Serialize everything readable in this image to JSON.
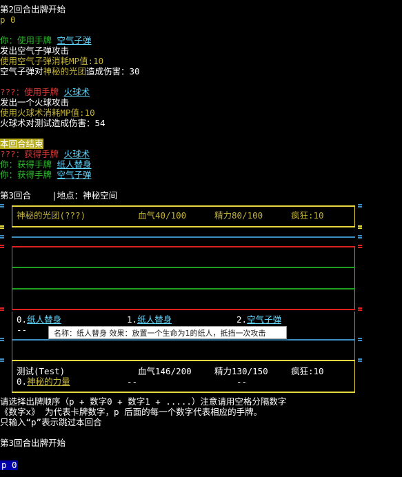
{
  "colors": {
    "white": "#ffffff",
    "green": "#2fbf2f",
    "olive": "#c4b33a",
    "red": "#d43a3a",
    "cyan": "#5fd7ff",
    "yellow_border": "#e6d73c",
    "blue_line": "#3b8fc4",
    "red_line": "#e02020",
    "green_line": "#1f9f1f"
  },
  "log": {
    "round2_start": "第2回合出牌开始",
    "p0_echo": "p 0",
    "you_use_prefix": "你：使用手牌 ",
    "card_air_bullet": "空气子弹",
    "fire_air": "发出空气子弹攻击",
    "air_mp": "使用空气子弹消耗MP值:10",
    "air_dmg_prefix": "空气子弹对",
    "air_dmg_target": "神秘的光团",
    "air_dmg_suffix": "造成伤害：30",
    "enemy_use_prefix": "???：使用手牌 ",
    "card_fireball": "火球术",
    "fire_fireball": "发出一个火球攻击",
    "fireball_mp": "使用火球术消耗MP值:10",
    "fireball_dmg": "火球术对测试造成伤害：54",
    "round_end": "本回合结束",
    "enemy_gain_prefix": "???：获得手牌 ",
    "you_gain_prefix": "你：获得手牌 ",
    "card_paper_double": "纸人替身",
    "round3_header_left": "第3回合",
    "round3_header_right": "|地点：神秘空间"
  },
  "enemy": {
    "name": "神秘的光团(???)",
    "hp": "血气40/100",
    "sp": "精力80/100",
    "madness": "疯狂:10"
  },
  "hand": {
    "slot0_num": "0.",
    "slot0_card": "纸人替身",
    "slot1_num": "1.",
    "slot1_card": "纸人替身",
    "slot2_num": "2.",
    "slot2_card": "空气子弹",
    "empty": "--"
  },
  "tooltip": {
    "text": "名称：纸人替身 效果：放置一个生命为1的纸人，抵挡一次攻击"
  },
  "player": {
    "name": "测试(Test)",
    "hp": "血气146/200",
    "sp": "精力130/150",
    "madness": "疯狂:10",
    "slot0_num": "0.",
    "slot0_card": "神秘的力量",
    "slot1": "--",
    "slot2": "--"
  },
  "instructions": {
    "line1": "请选择出牌顺序（p + 数字0 + 数字1 + .....）注意请用空格分隔数字",
    "line2": "《数字x》 为代表卡牌数字，p 后面的每一个数字代表相应的手牌。",
    "line3": "只输入“p”表示跳过本回合",
    "round3_start": "第3回合出牌开始"
  },
  "input": {
    "value": "p 0"
  }
}
